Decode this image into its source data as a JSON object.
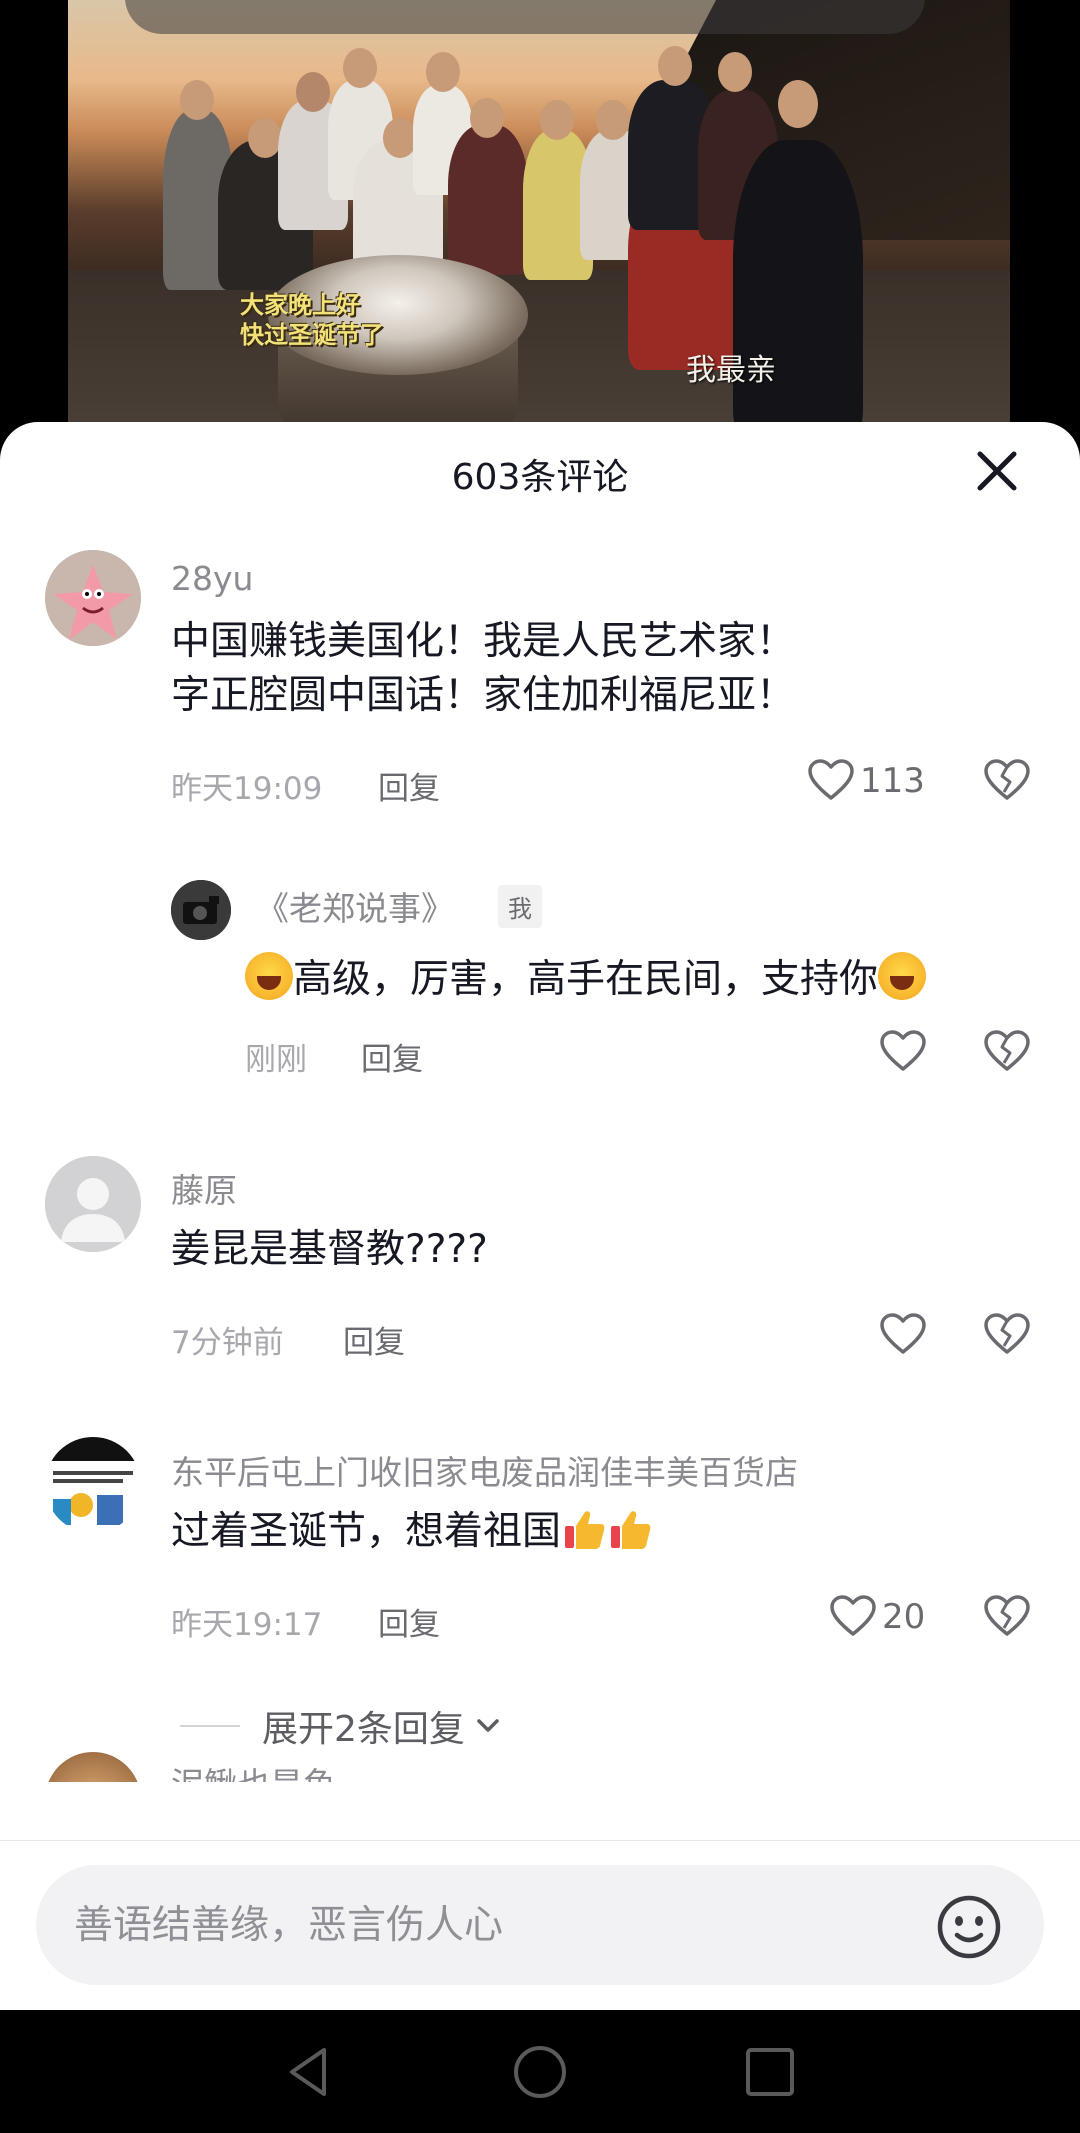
{
  "video": {
    "caption_left_line1": "大家晚上好",
    "caption_left_line2": "快过圣诞节了",
    "caption_right": "我最亲"
  },
  "sheet": {
    "title": "603条评论"
  },
  "comments": [
    {
      "username": "28yu",
      "text_line1": "中国赚钱美国化！我是人民艺术家！",
      "text_line2": "字正腔圆中国话！家住加利福尼亚！",
      "time": "昨天19:09",
      "reply_label": "回复",
      "likes": "113"
    },
    {
      "username": "《老郑说事》",
      "badge": "我",
      "text": "高级，厉害，高手在民间，支持你",
      "time": "刚刚",
      "reply_label": "回复"
    },
    {
      "username": "藤原",
      "text": "姜昆是基督教????",
      "time": "7分钟前",
      "reply_label": "回复"
    },
    {
      "username": "东平后屯上门收旧家电废品润佳丰美百货店",
      "text": "过着圣诞节，想着祖国",
      "time": "昨天19:17",
      "reply_label": "回复",
      "likes": "20"
    }
  ],
  "expand_replies": {
    "label": "展开2条回复"
  },
  "next_comment_peek": {
    "username": "泥鳅也是鱼"
  },
  "input": {
    "placeholder": "善语结善缘，恶言伤人心"
  },
  "colors": {
    "text_primary": "#161823",
    "text_secondary": "#8a8b91",
    "sheet_bg": "#ffffff",
    "input_bg": "#f2f2f4"
  }
}
